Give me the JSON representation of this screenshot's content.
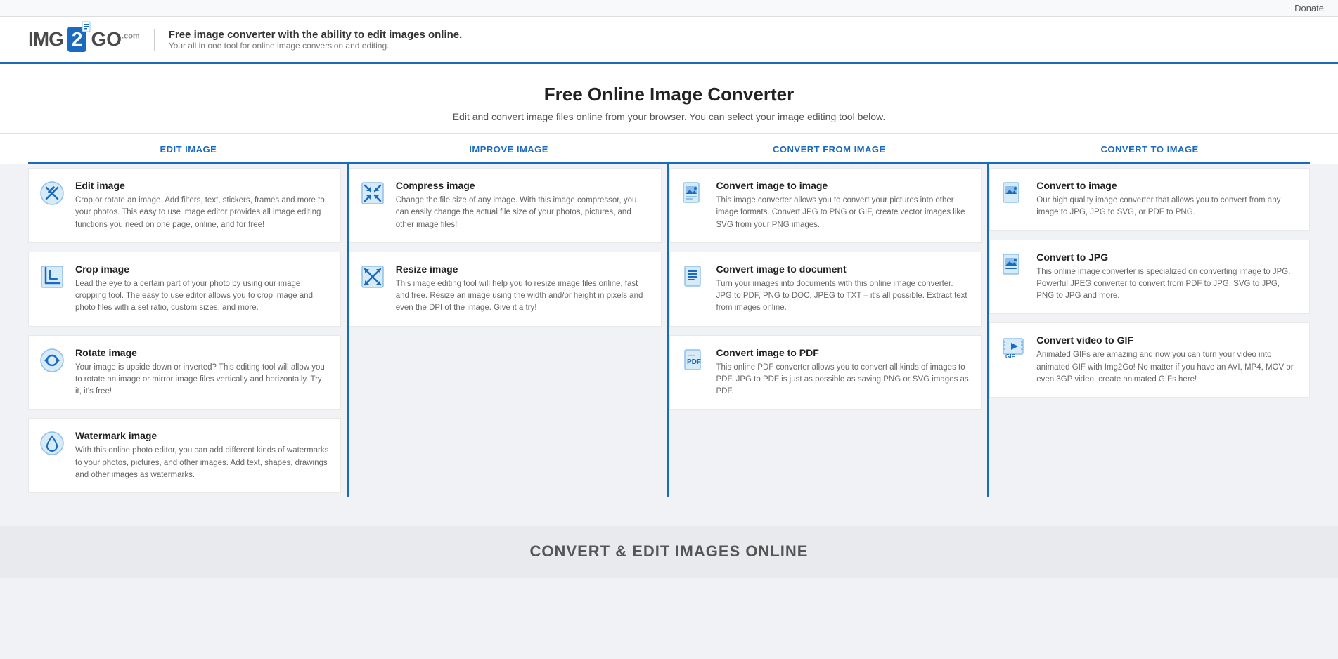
{
  "topbar": {
    "donate_label": "Donate"
  },
  "header": {
    "logo_img": "IMG",
    "logo_2": "2",
    "logo_go": "GO",
    "logo_com": ".com",
    "tagline_main": "Free image converter with the ability to edit images online.",
    "tagline_sub": "Your all in one tool for online image conversion and editing."
  },
  "hero": {
    "title": "Free Online Image Converter",
    "subtitle": "Edit and convert image files online from your browser. You can select your image editing tool below."
  },
  "columns": [
    {
      "label": "EDIT IMAGE"
    },
    {
      "label": "IMPROVE IMAGE"
    },
    {
      "label": "CONVERT FROM IMAGE"
    },
    {
      "label": "CONVERT TO IMAGE"
    }
  ],
  "edit_image_cards": [
    {
      "title": "Edit image",
      "description": "Crop or rotate an image. Add filters, text, stickers, frames and more to your photos. This easy to use image editor provides all image editing functions you need on one page, online, and for free!"
    },
    {
      "title": "Crop image",
      "description": "Lead the eye to a certain part of your photo by using our image cropping tool. The easy to use editor allows you to crop image and photo files with a set ratio, custom sizes, and more."
    },
    {
      "title": "Rotate image",
      "description": "Your image is upside down or inverted? This editing tool will allow you to rotate an image or mirror image files vertically and horizontally. Try it, it's free!"
    },
    {
      "title": "Watermark image",
      "description": "With this online photo editor, you can add different kinds of watermarks to your photos, pictures, and other images. Add text, shapes, drawings and other images as watermarks."
    }
  ],
  "improve_image_cards": [
    {
      "title": "Compress image",
      "description": "Change the file size of any image. With this image compressor, you can easily change the actual file size of your photos, pictures, and other image files!"
    },
    {
      "title": "Resize image",
      "description": "This image editing tool will help you to resize image files online, fast and free. Resize an image using the width and/or height in pixels and even the DPI of the image. Give it a try!"
    }
  ],
  "convert_from_cards": [
    {
      "title": "Convert image to image",
      "description": "This image converter allows you to convert your pictures into other image formats. Convert JPG to PNG or GIF, create vector images like SVG from your PNG images."
    },
    {
      "title": "Convert image to document",
      "description": "Turn your images into documents with this online image converter. JPG to PDF, PNG to DOC, JPEG to TXT – it's all possible. Extract text from images online."
    },
    {
      "title": "Convert image to PDF",
      "description": "This online PDF converter allows you to convert all kinds of images to PDF. JPG to PDF is just as possible as saving PNG or SVG images as PDF."
    }
  ],
  "convert_to_cards": [
    {
      "title": "Convert to image",
      "description": "Our high quality image converter that allows you to convert from any image to JPG, JPG to SVG, or PDF to PNG."
    },
    {
      "title": "Convert to JPG",
      "description": "This online image converter is specialized on converting image to JPG. Powerful JPEG converter to convert from PDF to JPG, SVG to JPG, PNG to JPG and more."
    },
    {
      "title": "Convert video to GIF",
      "description": "Animated GIFs are amazing and now you can turn your video into animated GIF with Img2Go! No matter if you have an AVI, MP4, MOV or even 3GP video, create animated GIFs here!"
    }
  ],
  "footer_label": "CONVERT & EDIT IMAGES ONLINE"
}
